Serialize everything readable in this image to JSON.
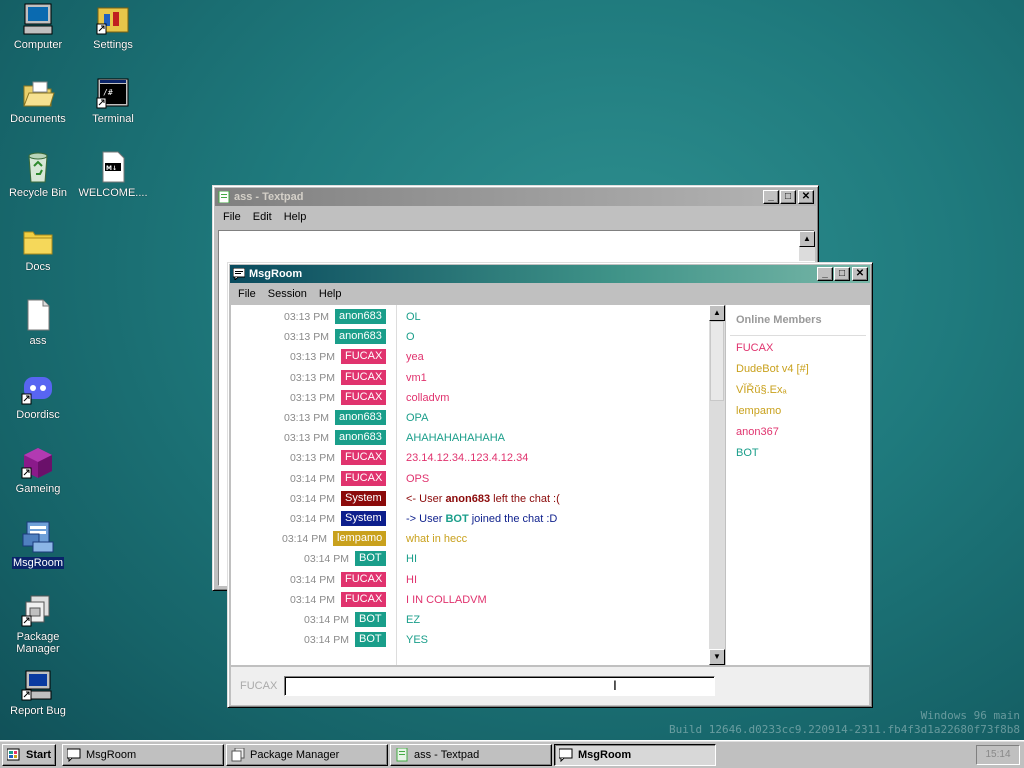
{
  "desktop": {
    "icons": [
      {
        "label": "Computer"
      },
      {
        "label": "Settings"
      },
      {
        "label": "Documents"
      },
      {
        "label": "Terminal"
      },
      {
        "label": "Recycle Bin"
      },
      {
        "label": "WELCOME...."
      },
      {
        "label": "Docs"
      },
      {
        "label": "ass"
      },
      {
        "label": "Doordisc"
      },
      {
        "label": "Gameing"
      },
      {
        "label": "MsgRoom"
      },
      {
        "label": "Package Manager"
      },
      {
        "label": "Report Bug"
      }
    ],
    "watermark_line1": "Windows 96 main",
    "watermark_line2": "Build 12646.d0233cc9.220914-2311.fb4f3d1a22680f73f8b8"
  },
  "textpad": {
    "title": "ass - Textpad",
    "menu": [
      "File",
      "Edit",
      "Help"
    ]
  },
  "msgroom": {
    "title": "MsgRoom",
    "menu": [
      "File",
      "Session",
      "Help"
    ],
    "messages": [
      {
        "time": "03:13 PM",
        "user": "anon683",
        "color": "#1a9e8a",
        "text": "OL",
        "text_color": "#1a9e8a"
      },
      {
        "time": "03:13 PM",
        "user": "anon683",
        "color": "#1a9e8a",
        "text": "O",
        "text_color": "#1a9e8a"
      },
      {
        "time": "03:13 PM",
        "user": "FUCAX",
        "color": "#e0336e",
        "text": "yea",
        "text_color": "#e0336e"
      },
      {
        "time": "03:13 PM",
        "user": "FUCAX",
        "color": "#e0336e",
        "text": "vm1",
        "text_color": "#e0336e"
      },
      {
        "time": "03:13 PM",
        "user": "FUCAX",
        "color": "#e0336e",
        "text": "colladvm",
        "text_color": "#e0336e"
      },
      {
        "time": "03:13 PM",
        "user": "anon683",
        "color": "#1a9e8a",
        "text": "OPA",
        "text_color": "#1a9e8a"
      },
      {
        "time": "03:13 PM",
        "user": "anon683",
        "color": "#1a9e8a",
        "text": "AHAHAHAHAHAHA",
        "text_color": "#1a9e8a"
      },
      {
        "time": "03:13 PM",
        "user": "FUCAX",
        "color": "#e0336e",
        "text": "23.14.12.34..123.4.12.34",
        "text_color": "#e0336e"
      },
      {
        "time": "03:14 PM",
        "user": "FUCAX",
        "color": "#e0336e",
        "text": "OPS",
        "text_color": "#e0336e"
      },
      {
        "time": "03:14 PM",
        "user": "System",
        "color": "#8b0a0a",
        "text_pre": "<- User ",
        "text_user": "anon683",
        "text_post": " left the chat :(",
        "text_color": "#8b0a0a"
      },
      {
        "time": "03:14 PM",
        "user": "System",
        "color": "#0d1f8c",
        "text_pre": "-> User ",
        "text_user": "BOT",
        "text_post": " joined the chat :D",
        "text_color": "#0d1f8c",
        "user_color": "#1a9e8a"
      },
      {
        "time": "03:14 PM",
        "user": "lempamo",
        "color": "#c9a11d",
        "text": "what in hecc",
        "text_color": "#c9a11d"
      },
      {
        "time": "03:14 PM",
        "user": "BOT",
        "color": "#1a9e8a",
        "text": "HI",
        "text_color": "#1a9e8a"
      },
      {
        "time": "03:14 PM",
        "user": "FUCAX",
        "color": "#e0336e",
        "text": "HI",
        "text_color": "#e0336e"
      },
      {
        "time": "03:14 PM",
        "user": "FUCAX",
        "color": "#e0336e",
        "text": "I IN COLLADVM",
        "text_color": "#e0336e"
      },
      {
        "time": "03:14 PM",
        "user": "BOT",
        "color": "#1a9e8a",
        "text": "EZ",
        "text_color": "#1a9e8a"
      },
      {
        "time": "03:14 PM",
        "user": "BOT",
        "color": "#1a9e8a",
        "text": "YES",
        "text_color": "#1a9e8a"
      }
    ],
    "members_header": "Online Members",
    "members": [
      {
        "name": "FUCAX",
        "color": "#e0336e"
      },
      {
        "name": "DudeBot v4 [#]",
        "color": "#c9a11d"
      },
      {
        "name": "VĬŘŭ§.Exₐ",
        "color": "#c9a11d"
      },
      {
        "name": "lempamo",
        "color": "#c9a11d"
      },
      {
        "name": "anon367",
        "color": "#e0336e"
      },
      {
        "name": "BOT",
        "color": "#1a9e8a"
      }
    ],
    "input_label": "FUCAX",
    "input_value": ""
  },
  "taskbar": {
    "start_label": "Start",
    "buttons": [
      {
        "label": "MsgRoom"
      },
      {
        "label": "Package Manager"
      },
      {
        "label": "ass - Textpad"
      },
      {
        "label": "MsgRoom"
      }
    ],
    "clock": "15:14"
  }
}
